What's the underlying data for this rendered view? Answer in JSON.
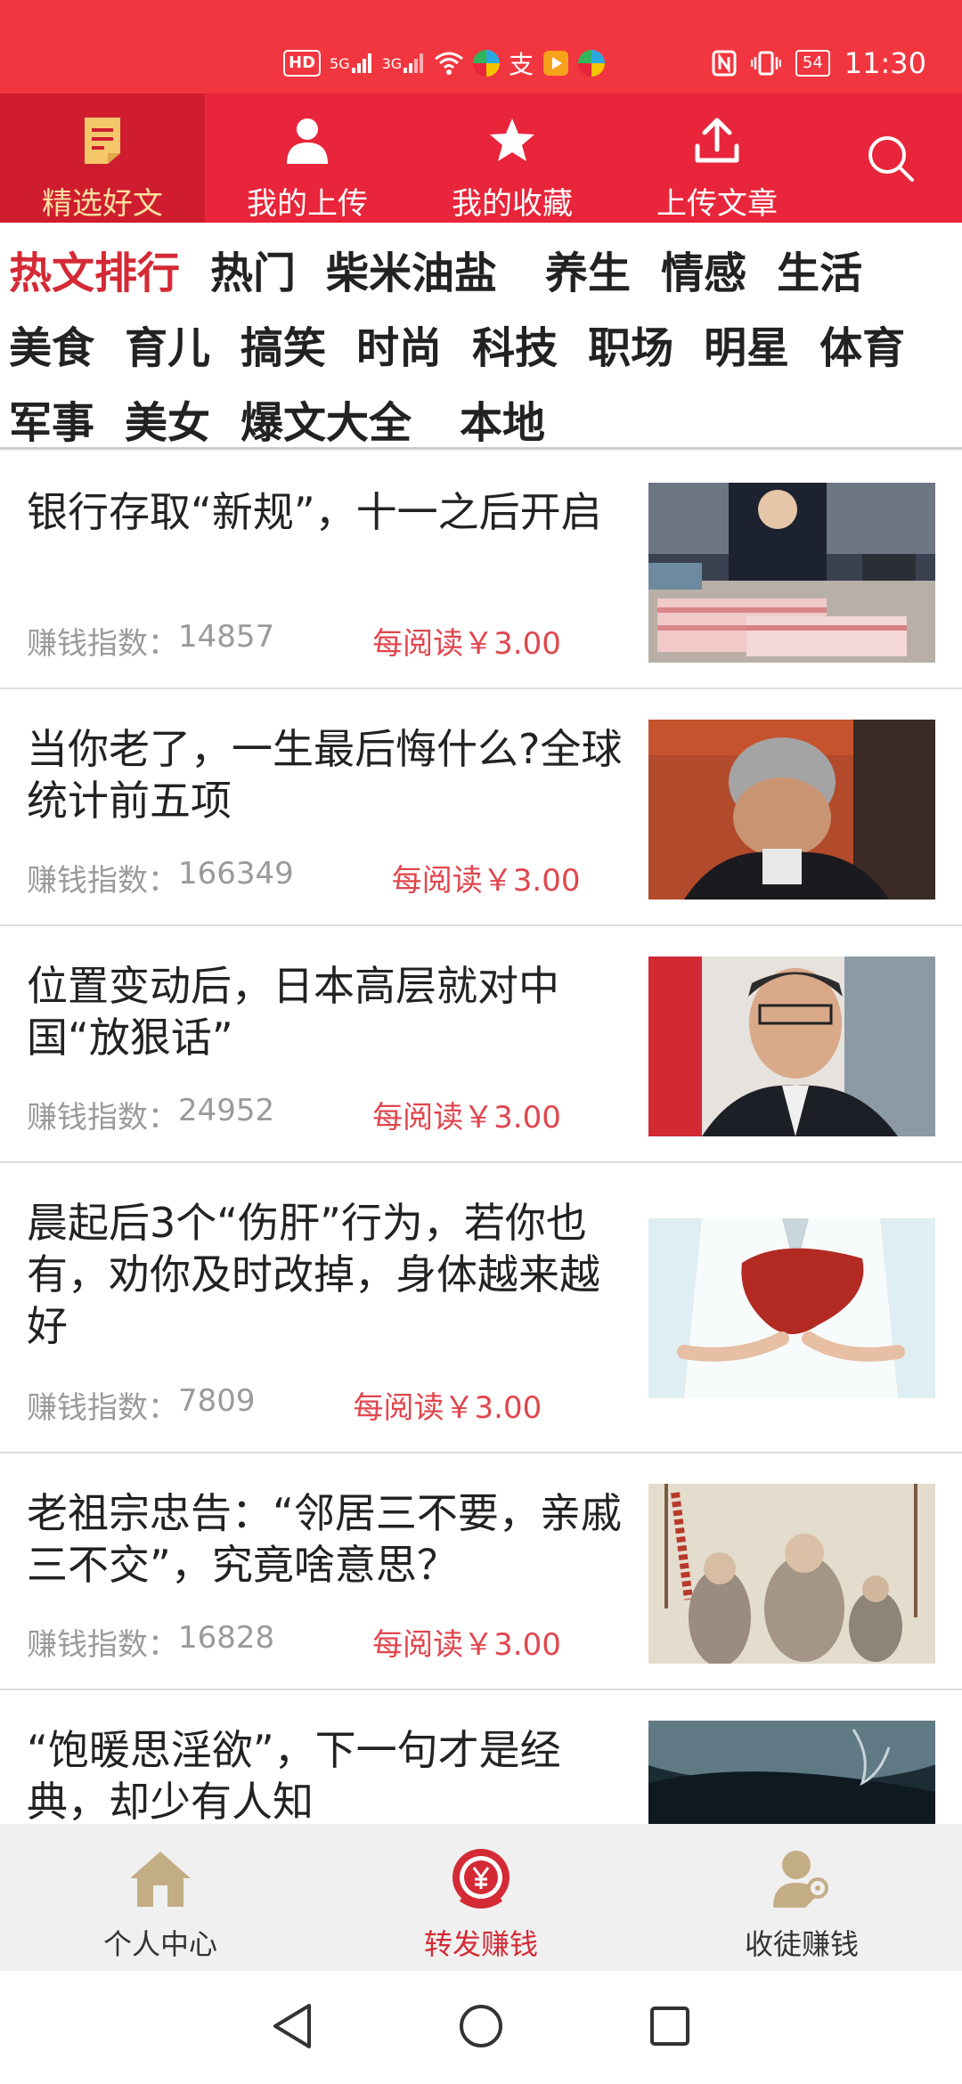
{
  "status_bar": {
    "hd": "HD",
    "net1": "5G",
    "net2": "3G",
    "zhi": "支",
    "battery": "54",
    "time": "11:30"
  },
  "top_tabs": [
    {
      "label": "精选好文",
      "icon": "article-icon"
    },
    {
      "label": "我的上传",
      "icon": "user-icon"
    },
    {
      "label": "我的收藏",
      "icon": "star-icon"
    },
    {
      "label": "上传文章",
      "icon": "upload-icon"
    }
  ],
  "categories": [
    [
      "热文排行",
      "热门",
      "柴米油盐",
      "养生",
      "情感",
      "生活"
    ],
    [
      "美食",
      "育儿",
      "搞笑",
      "时尚",
      "科技",
      "职场",
      "明星",
      "体育"
    ],
    [
      "军事",
      "美女",
      "爆文大全",
      "本地"
    ]
  ],
  "meta_label": "赚钱指数：",
  "articles": [
    {
      "title": "银行存取“新规”，十一之后开启",
      "score": "14857",
      "price": "每阅读￥3.00"
    },
    {
      "title": "当你老了，一生最后悔什么?全球统计前五项",
      "score": "166349",
      "price": "每阅读￥3.00"
    },
    {
      "title": "位置变动后，日本高层就对中国“放狠话”",
      "score": "24952",
      "price": "每阅读￥3.00"
    },
    {
      "title": "晨起后3个“伤肝”行为，若你也有，劝你及时改掉，身体越来越好",
      "score": "7809",
      "price": "每阅读￥3.00"
    },
    {
      "title": "老祖宗忠告：“邻居三不要，亲戚三不交”，究竟啥意思？",
      "score": "16828",
      "price": "每阅读￥3.00"
    },
    {
      "title": "“饱暖思淫欲”，下一句才是经典，却少有人知",
      "score": "",
      "price": ""
    }
  ],
  "bottom_nav": [
    {
      "label": "个人中心",
      "icon": "home-icon"
    },
    {
      "label": "转发赚钱",
      "icon": "yuan-icon"
    },
    {
      "label": "收徒赚钱",
      "icon": "apprentice-icon"
    }
  ],
  "colors": {
    "header_red": "#e8253a",
    "accent_red": "#d42a35",
    "price_red": "#e0464e",
    "active_tab_text": "#ffe0a0"
  }
}
